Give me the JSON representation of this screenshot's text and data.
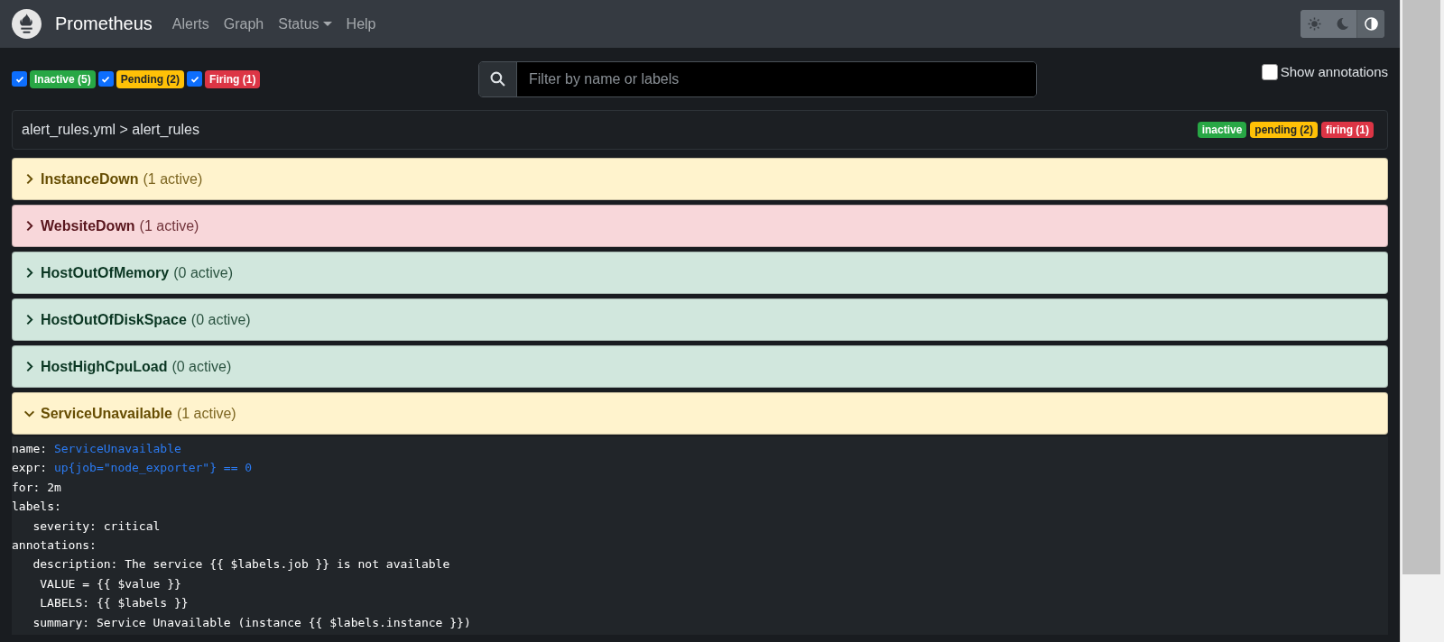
{
  "navbar": {
    "brand": "Prometheus",
    "links": [
      {
        "label": "Alerts",
        "dropdown": false
      },
      {
        "label": "Graph",
        "dropdown": false
      },
      {
        "label": "Status",
        "dropdown": true
      },
      {
        "label": "Help",
        "dropdown": false
      }
    ],
    "theme_buttons": [
      {
        "kind": "light",
        "selected": false
      },
      {
        "kind": "dark",
        "selected": false
      },
      {
        "kind": "auto",
        "selected": true
      }
    ]
  },
  "filters": [
    {
      "label": "Inactive (5)",
      "kind": "inactive",
      "checked": true
    },
    {
      "label": "Pending (2)",
      "kind": "pending",
      "checked": true
    },
    {
      "label": "Firing (1)",
      "kind": "firing",
      "checked": true
    }
  ],
  "search": {
    "placeholder": "Filter by name or labels"
  },
  "show_annotations": {
    "label": "Show annotations",
    "checked": false
  },
  "group": {
    "title": "alert_rules.yml > alert_rules",
    "badges": [
      {
        "label": "inactive",
        "kind": "inactive"
      },
      {
        "label": "pending (2)",
        "kind": "pending"
      },
      {
        "label": "firing (1)",
        "kind": "firing"
      }
    ]
  },
  "rules": [
    {
      "name": "InstanceDown",
      "count": "(1 active)",
      "kind": "pending",
      "expanded": false
    },
    {
      "name": "WebsiteDown",
      "count": "(1 active)",
      "kind": "firing",
      "expanded": false
    },
    {
      "name": "HostOutOfMemory",
      "count": "(0 active)",
      "kind": "inactive",
      "expanded": false
    },
    {
      "name": "HostOutOfDiskSpace",
      "count": "(0 active)",
      "kind": "inactive",
      "expanded": false
    },
    {
      "name": "HostHighCpuLoad",
      "count": "(0 active)",
      "kind": "inactive",
      "expanded": false
    },
    {
      "name": "ServiceUnavailable",
      "count": "(1 active)",
      "kind": "pending",
      "expanded": true,
      "definition": [
        {
          "key": "name:",
          "value": "ServiceUnavailable",
          "highlighted": true
        },
        {
          "key": "expr:",
          "value": "up{job=\"node_exporter\"} == 0",
          "highlighted": true
        },
        {
          "key": "for:",
          "value": "2m",
          "highlighted": false
        },
        {
          "key": "labels:",
          "children": [
            {
              "key": "severity:",
              "value": "critical"
            }
          ]
        },
        {
          "key": "annotations:",
          "children": [
            {
              "key": "description:",
              "value": "The service {{ $labels.job }} is not available\n VALUE = {{ $value }}\n LABELS: {{ $labels }}"
            },
            {
              "key": "summary:",
              "value": "Service Unavailable (instance {{ $labels.instance }})"
            }
          ]
        }
      ]
    }
  ]
}
